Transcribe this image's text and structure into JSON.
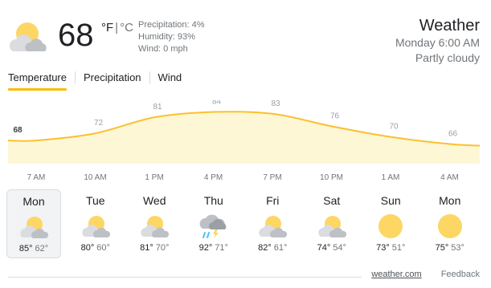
{
  "current": {
    "temp": "68",
    "unit_f": "°F",
    "unit_sep": "|",
    "unit_c": "°C",
    "precipitation": "Precipitation: 4%",
    "humidity": "Humidity: 93%",
    "wind": "Wind: 0 mph",
    "icon": "partly-cloudy-icon"
  },
  "header": {
    "title": "Weather",
    "datetime": "Monday 6:00 AM",
    "condition": "Partly cloudy"
  },
  "tabs": [
    "Temperature",
    "Precipitation",
    "Wind"
  ],
  "chart_data": {
    "type": "area",
    "x": [
      "7 AM",
      "10 AM",
      "1 PM",
      "4 PM",
      "7 PM",
      "10 PM",
      "1 AM",
      "4 AM"
    ],
    "values": [
      68,
      72,
      81,
      84,
      83,
      76,
      70,
      66
    ],
    "point_labels": [
      "68",
      "72",
      "81",
      "84",
      "83",
      "76",
      "70",
      "66"
    ],
    "ylim": [
      55,
      100
    ],
    "colors": {
      "line": "#fbc02d",
      "fill": "#fef7d6",
      "label": "#9aa0a6",
      "first_label": "#3c4043"
    }
  },
  "forecast": [
    {
      "day": "Mon",
      "hi": "85°",
      "lo": "62°",
      "icon": "partly-cloudy-icon"
    },
    {
      "day": "Tue",
      "hi": "80°",
      "lo": "60°",
      "icon": "partly-cloudy-icon"
    },
    {
      "day": "Wed",
      "hi": "81°",
      "lo": "70°",
      "icon": "partly-cloudy-icon"
    },
    {
      "day": "Thu",
      "hi": "92°",
      "lo": "71°",
      "icon": "thunderstorm-icon"
    },
    {
      "day": "Fri",
      "hi": "82°",
      "lo": "61°",
      "icon": "partly-cloudy-icon"
    },
    {
      "day": "Sat",
      "hi": "74°",
      "lo": "54°",
      "icon": "partly-cloudy-icon"
    },
    {
      "day": "Sun",
      "hi": "73°",
      "lo": "51°",
      "icon": "sunny-icon"
    },
    {
      "day": "Mon",
      "hi": "75°",
      "lo": "53°",
      "icon": "sunny-icon"
    }
  ],
  "footer": {
    "source": "weather.com",
    "feedback": "Feedback"
  }
}
